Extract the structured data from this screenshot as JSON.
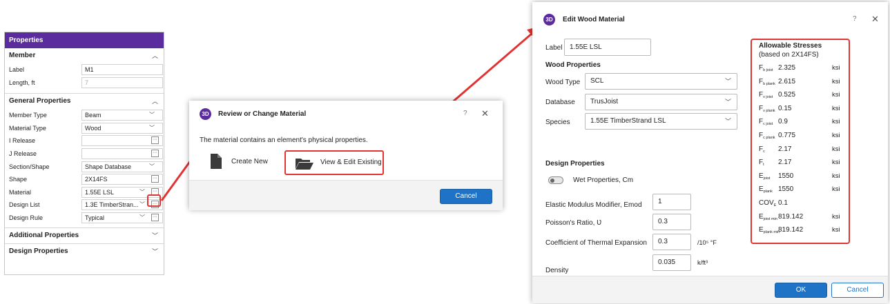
{
  "properties_panel": {
    "title": "Properties",
    "member_section": "Member",
    "member_rows": [
      {
        "key": "Label",
        "value": "M1"
      },
      {
        "key": "Length, ft",
        "value": "7"
      }
    ],
    "general_section": "General Properties",
    "general_rows": [
      {
        "key": "Member Type",
        "value": "Beam"
      },
      {
        "key": "Material Type",
        "value": "Wood"
      },
      {
        "key": "I Release",
        "value": ""
      },
      {
        "key": "J Release",
        "value": ""
      },
      {
        "key": "Section/Shape",
        "value": "Shape Database"
      },
      {
        "key": "Shape",
        "value": "2X14FS"
      },
      {
        "key": "Material",
        "value": "1.55E LSL"
      },
      {
        "key": "Design List",
        "value": "1.3E TimberStran..."
      },
      {
        "key": "Design Rule",
        "value": "Typical"
      }
    ],
    "additional_section": "Additional Properties",
    "design_section": "Design Properties",
    "ellipsis": "···"
  },
  "review_dialog": {
    "logo": "3D",
    "title": "Review or Change Material",
    "help": "?",
    "close": "✕",
    "message": "The material contains an element's physical properties.",
    "create_new": "Create New",
    "view_edit": "View & Edit Existing",
    "cancel": "Cancel"
  },
  "edit_dialog": {
    "logo": "3D",
    "title": "Edit Wood Material",
    "help": "?",
    "close": "✕",
    "label_caption": "Label",
    "label_value": "1.55E LSL",
    "wood_properties_heading": "Wood Properties",
    "wood_type_caption": "Wood Type",
    "wood_type_value": "SCL",
    "database_caption": "Database",
    "database_value": "TrusJoist",
    "species_caption": "Species",
    "species_value": "1.55E TimberStrand LSL",
    "design_properties_heading": "Design Properties",
    "wet_caption": "Wet Properties, Cm",
    "emod_caption": "Elastic Modulus Modifier, Emod",
    "emod_value": "1",
    "poisson_caption": "Poisson's Ratio, Ʋ",
    "poisson_value": "0.3",
    "thermal_caption": "Coefficient of Thermal Expansion",
    "thermal_value": "0.3",
    "thermal_unit": "/10⁵ °F",
    "density_caption": "Density",
    "density_value": "0.035",
    "density_unit": "k/ft³",
    "ok": "OK",
    "cancel": "Cancel",
    "stresses": {
      "title": "Allowable Stresses",
      "subtitle": "(based on 2X14FS)",
      "rows": [
        {
          "sym": "F",
          "sub": "b joist",
          "value": "2.325",
          "unit": "ksi"
        },
        {
          "sym": "F",
          "sub": "b plank",
          "value": "2.615",
          "unit": "ksi"
        },
        {
          "sym": "F",
          "sub": "v joist",
          "value": "0.525",
          "unit": "ksi"
        },
        {
          "sym": "F",
          "sub": "v plank",
          "value": "0.15",
          "unit": "ksi"
        },
        {
          "sym": "F",
          "sub": "c joist",
          "value": "0.9",
          "unit": "ksi"
        },
        {
          "sym": "F",
          "sub": "c plank",
          "value": "0.775",
          "unit": "ksi"
        },
        {
          "sym": "F",
          "sub": "c",
          "value": "2.17",
          "unit": "ksi"
        },
        {
          "sym": "F",
          "sub": "t",
          "value": "2.17",
          "unit": "ksi"
        },
        {
          "sym": "E",
          "sub": "joist",
          "value": "1550",
          "unit": "ksi"
        },
        {
          "sym": "E",
          "sub": "plank",
          "value": "1550",
          "unit": "ksi"
        },
        {
          "sym": "COV",
          "sub": "E",
          "value": "0.1",
          "unit": ""
        },
        {
          "sym": "E",
          "sub": "joist min",
          "value": "819.142",
          "unit": "ksi"
        },
        {
          "sym": "E",
          "sub": "plank min",
          "value": "819.142",
          "unit": "ksi"
        }
      ]
    }
  },
  "colors": {
    "brand_purple": "#5b2c9e",
    "highlight_red": "#e23333",
    "primary_blue": "#1f73c7"
  }
}
